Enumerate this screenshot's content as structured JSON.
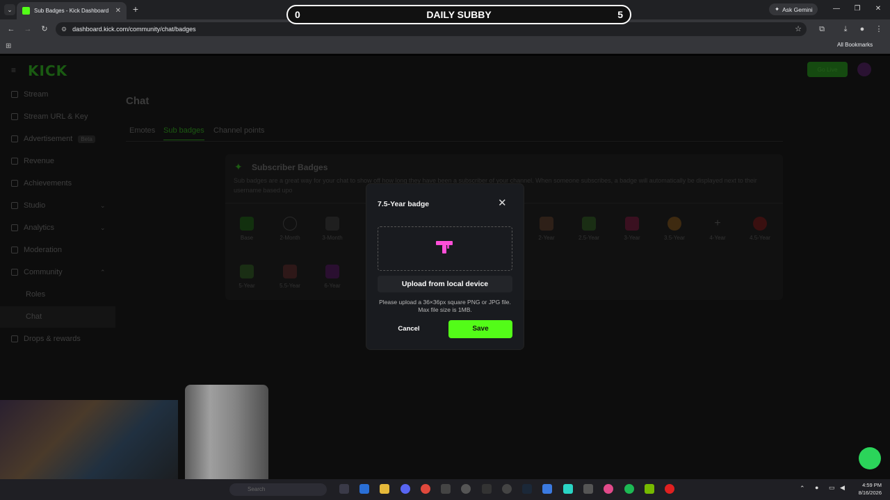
{
  "browser": {
    "tab_title": "Sub Badges - Kick Dashboard",
    "url": "dashboard.kick.com/community/chat/badges",
    "gemini_label": "Ask Gemini",
    "all_bookmarks": "All Bookmarks"
  },
  "overlay": {
    "left_score": "0",
    "title": "DAILY SUBBY",
    "right_score": "5"
  },
  "header": {
    "logo": "KICK",
    "go_live": "Go Live"
  },
  "sidebar": {
    "items": [
      {
        "label": "Stream"
      },
      {
        "label": "Stream URL & Key"
      },
      {
        "label": "Advertisement",
        "badge": "Beta"
      },
      {
        "label": "Revenue"
      },
      {
        "label": "Achievements"
      },
      {
        "label": "Studio"
      },
      {
        "label": "Analytics"
      },
      {
        "label": "Moderation"
      },
      {
        "label": "Community"
      },
      {
        "label": "Roles"
      },
      {
        "label": "Chat"
      },
      {
        "label": "Drops & rewards"
      }
    ]
  },
  "main": {
    "title": "Chat",
    "tabs": [
      "Emotes",
      "Sub badges",
      "Channel points"
    ],
    "card_title": "Subscriber Badges",
    "card_desc": "Sub badges are a great way for your chat to show off how long they have been a subscriber of your channel. When someone subscribes, a badge will automatically be displayed next to their username based upo",
    "badges_row1": [
      "Base",
      "2-Month",
      "3-Month",
      "2-Year",
      "2.5-Year",
      "3-Year",
      "3.5-Year",
      "4-Year",
      "4.5-Year"
    ],
    "badges_row2": [
      "5-Year",
      "5.5-Year",
      "6-Year"
    ]
  },
  "modal": {
    "title": "7.5-Year badge",
    "upload_label": "Upload from local device",
    "hint": "Please upload a 36×36px square PNG or JPG file. Max file size is 1MB.",
    "cancel_label": "Cancel",
    "save_label": "Save"
  },
  "taskbar": {
    "search_placeholder": "Search",
    "time": "4:59 PM",
    "date": "8/16/2026"
  },
  "colors": {
    "accent": "#53fc18",
    "modal_bg": "#191b1f"
  }
}
